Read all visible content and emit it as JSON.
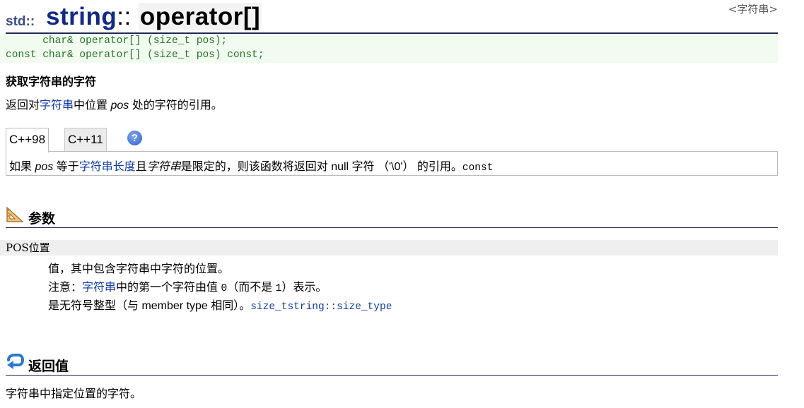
{
  "header": {
    "namespace": "std::",
    "class_name": "string",
    "scope_sep": "::",
    "member": "operator[]",
    "breadcrumb": "<字符串>"
  },
  "prototypes": [
    "      char& operator[] (size_t pos);",
    "const char& operator[] (size_t pos) const;"
  ],
  "summary": "获取字符串的字符",
  "description": {
    "p1": "返回对",
    "link": "字符串",
    "p2": "中位置 ",
    "param": "pos",
    "p3": " 处的字符的引用。"
  },
  "tabs": [
    "C++98",
    "C++11"
  ],
  "help_icon": "?",
  "tab_content": {
    "p1": "如果 ",
    "param": "pos",
    "p2": " 等于",
    "link": "字符串长度",
    "p3": "且",
    "italic": "字符串",
    "p4": "是限定的，则该函数将返回对 null 字符 （'\\0'） 的引用。",
    "code": "const"
  },
  "params_section": {
    "title": "参数",
    "icon": "ruler-triangle-icon",
    "param_name": "POS位置",
    "line1": "值，其中包含字符串中字符的位置。",
    "line2_a": "注意：",
    "line2_link": "字符串",
    "line2_b": "中的第一个字符由值 ",
    "line2_code0": "0",
    "line2_c": "（而不是 ",
    "line2_code1": "1",
    "line2_d": "）表示。",
    "line3_a": "是无符号整型（与 member type 相同）。",
    "line3_code": "size_tstring::size_type"
  },
  "return_section": {
    "title": "返回值",
    "icon": "return-arrow-icon",
    "text": "字符串中指定位置的字符。"
  },
  "colors": {
    "title_blue": "#0f2a88",
    "link_blue": "#0e3ba8",
    "proto_green": "#227522",
    "proto_bg": "#f2fbf0",
    "rule_navy": "#1c2a56"
  }
}
